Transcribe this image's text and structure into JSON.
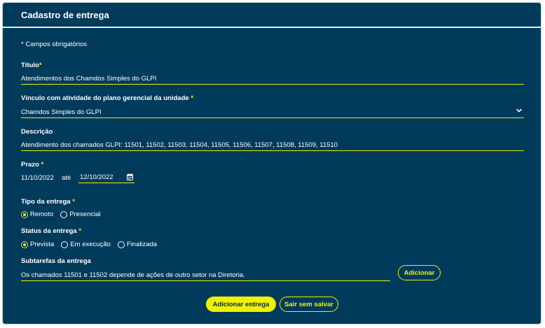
{
  "form": {
    "title": "Cadastro de entrega",
    "required_note": "* Campos obrigatórios",
    "required_mark": "*",
    "titulo": {
      "label": "Título",
      "value": "Atendimentos dos Chamdos Simples do GLPI"
    },
    "vinculo": {
      "label": "Vínculo com atividade do plano gerencial da unidade",
      "value": "Chamdos Simples do GLPI"
    },
    "descricao": {
      "label": "Descrição",
      "value": "Atendimento dos chamados GLPI: 11501, 11502, 11503, 11504, 11505, 11506, 11507, 11508, 11509, 11510"
    },
    "prazo": {
      "label": "Prazo",
      "start": "11/10/2022",
      "separator": "até",
      "end": "12/10/2022"
    },
    "tipo": {
      "label": "Tipo da entrega",
      "options": [
        "Remoto",
        "Presencial"
      ],
      "selected": "Remoto"
    },
    "status": {
      "label": "Status da entrega",
      "options": [
        "Prevista",
        "Em execução",
        "Finalizada"
      ],
      "selected": "Prevista"
    },
    "subtarefas": {
      "label": "Subtarefas da entrega",
      "value": "Os chamados 11501 e 11502 depende de ações de outro setor na Diretoria.",
      "add_label": "Adicionar"
    },
    "actions": {
      "submit": "Adicionar entrega",
      "cancel": "Sair sem salvar"
    }
  },
  "colors": {
    "background": "#003b5c",
    "accent": "#f0f000",
    "text": "#ffffff"
  },
  "icons": {
    "select": "chevron-down-icon",
    "date": "calendar-icon"
  }
}
